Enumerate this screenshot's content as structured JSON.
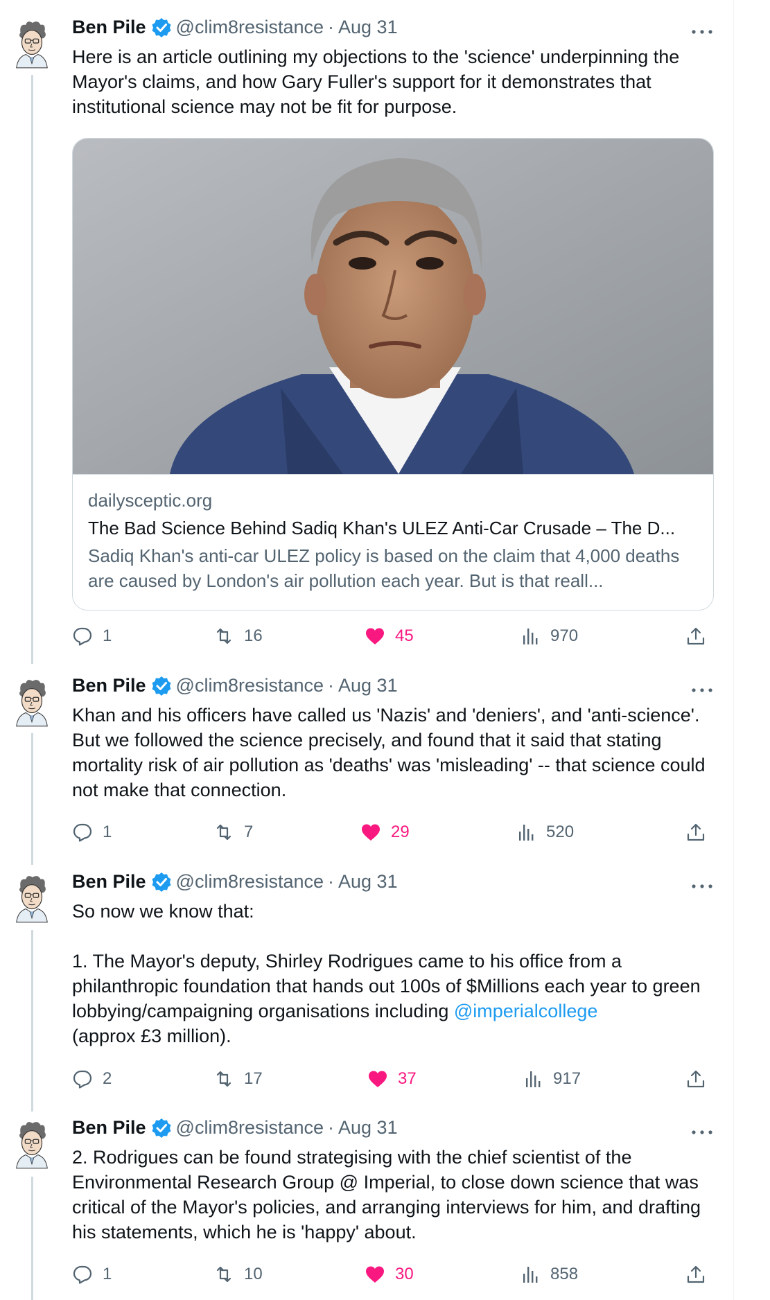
{
  "author": {
    "name": "Ben Pile",
    "handle": "@clim8resistance",
    "verified_color": "#1d9bf0"
  },
  "colors": {
    "like": "#f91880",
    "mention": "#1d9bf0",
    "muted": "#536471",
    "thread_line": "#cfd9de"
  },
  "tweets": [
    {
      "name": "Ben Pile",
      "handle": "@clim8resistance",
      "separator": "·",
      "time": "Aug 31",
      "text": "Here is an article outlining my objections to the 'science' underpinning the Mayor's claims, and how Gary Fuller's support for it demonstrates that institutional science may not be fit for purpose.",
      "card": {
        "domain": "dailysceptic.org",
        "title": "The Bad Science Behind Sadiq Khan's ULEZ Anti-Car Crusade – The D...",
        "description": "Sadiq Khan's anti-car ULEZ policy is based on the claim that 4,000 deaths are caused by London's air pollution each year. But is that reall..."
      },
      "replies": "1",
      "retweets": "16",
      "likes": "45",
      "views": "970"
    },
    {
      "name": "Ben Pile",
      "handle": "@clim8resistance",
      "separator": "·",
      "time": "Aug 31",
      "text": "Khan and his officers have called us 'Nazis' and 'deniers', and 'anti-science'. But we followed the science precisely, and found that it said that stating mortality risk of air pollution as 'deaths' was 'misleading' -- that science could not make that connection.",
      "replies": "1",
      "retweets": "7",
      "likes": "29",
      "views": "520"
    },
    {
      "name": "Ben Pile",
      "handle": "@clim8resistance",
      "separator": "·",
      "time": "Aug 31",
      "text_before_mention": "So now we know that:\n\n1. The Mayor's deputy, Shirley Rodrigues came to his office from a philanthropic foundation that hands out 100s of $Millions each year to green lobbying/campaigning organisations including ",
      "mention": "@imperialcollege",
      "text_after_mention": "\n(approx £3 million).",
      "replies": "2",
      "retweets": "17",
      "likes": "37",
      "views": "917"
    },
    {
      "name": "Ben Pile",
      "handle": "@clim8resistance",
      "separator": "·",
      "time": "Aug 31",
      "text": "2. Rodrigues can be found strategising with the chief scientist of the Environmental Research Group @ Imperial, to close down science that was critical of the Mayor's policies, and arranging interviews for him, and drafting his statements, which he is 'happy' about.",
      "replies": "1",
      "retweets": "10",
      "likes": "30",
      "views": "858"
    }
  ]
}
